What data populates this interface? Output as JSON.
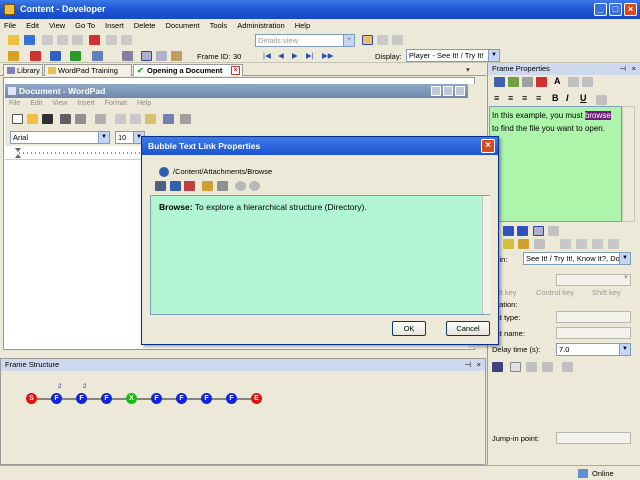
{
  "window": {
    "title": "Content - Developer"
  },
  "menu": [
    "File",
    "Edit",
    "View",
    "Go To",
    "Insert",
    "Delete",
    "Document",
    "Tools",
    "Administration",
    "Help"
  ],
  "toolbar": {
    "view_combo": "Details view",
    "frame_id_label": "Frame ID:",
    "frame_id_value": "30",
    "display_label": "Display:",
    "display_value": "Player - See It! / Try It!"
  },
  "tabs": [
    {
      "label": "Library"
    },
    {
      "label": "WordPad Training"
    },
    {
      "label": "Opening a Document"
    }
  ],
  "wordpad": {
    "title": "Document - WordPad",
    "menu": [
      "File",
      "Edit",
      "View",
      "Insert",
      "Format",
      "Help"
    ],
    "font": "Arial",
    "size": "10"
  },
  "frame_structure": {
    "title": "Frame Structure",
    "nodes": [
      {
        "letter": "S",
        "color": "#e01010",
        "badge": ""
      },
      {
        "letter": "F",
        "color": "#1024e0",
        "badge": "2"
      },
      {
        "letter": "F",
        "color": "#1024e0",
        "badge": "2"
      },
      {
        "letter": "F",
        "color": "#1024e0",
        "badge": ""
      },
      {
        "letter": "X",
        "color": "#10c010",
        "badge": ""
      },
      {
        "letter": "F",
        "color": "#1024e0",
        "badge": ""
      },
      {
        "letter": "F",
        "color": "#1024e0",
        "badge": ""
      },
      {
        "letter": "F",
        "color": "#1024e0",
        "badge": ""
      },
      {
        "letter": "F",
        "color": "#1024e0",
        "badge": ""
      },
      {
        "letter": "E",
        "color": "#e01010",
        "badge": ""
      }
    ]
  },
  "frame_properties": {
    "title": "Frame Properties",
    "text_before": "In this example, you must ",
    "text_highlight": "browse",
    "text_after": " to find the file you want to open.",
    "view_in_label": "w in:",
    "view_in_value": "See It! / Try It!, Know It?, Do It!",
    "alt_key": "Alt key",
    "control_key": "Control key",
    "shift_key": "Shift key",
    "application_label": "lication:",
    "object_type_label": "ect type:",
    "object_name_label": "ect name:",
    "delay_label": "Delay time (s):",
    "delay_value": "7.0",
    "jump_in_label": "Jump-in point:"
  },
  "dialog": {
    "title": "Bubble Text Link Properties",
    "path": "/Content/Attachments/Browse",
    "term": "Browse:",
    "definition": " To explore a hierarchical structure (Directory).",
    "ok": "OK",
    "cancel": "Cancel"
  },
  "status": {
    "text": "Online"
  },
  "colors": {
    "accent": "#1f59d6",
    "bubble_bg": "#aef5ac",
    "dialog_bg": "#b1f5d4",
    "highlight": "#6e1e7b"
  }
}
